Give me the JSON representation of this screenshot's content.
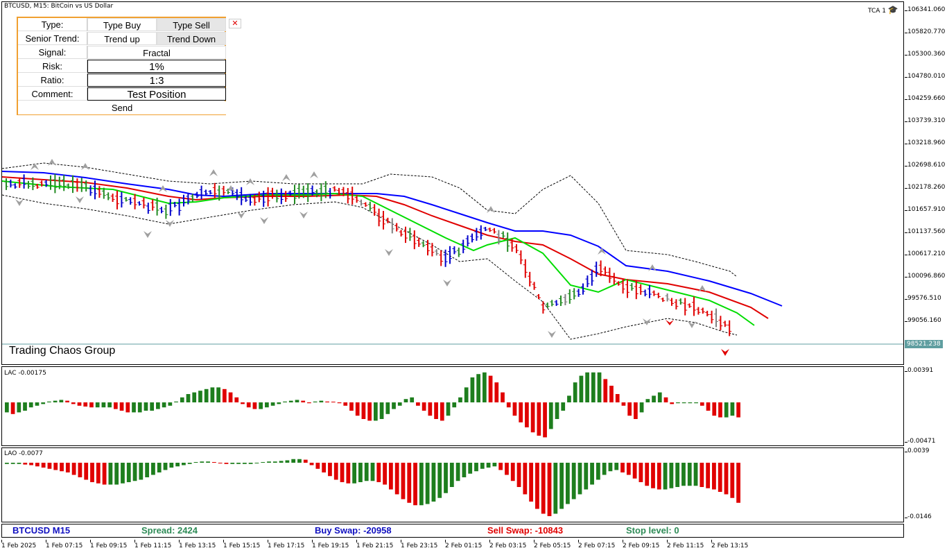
{
  "chart": {
    "symbol_title": "BTCUSD, M15:  BitCoin vs US Dollar",
    "indicator_tag": "TCA 1",
    "watermark": "Trading Chaos Group",
    "current_price": "98521.238",
    "price_ticks": [
      "106341.060",
      "105820.770",
      "105300.360",
      "104780.010",
      "104259.660",
      "103739.310",
      "103218.960",
      "102698.610",
      "102178.260",
      "101657.910",
      "101137.560",
      "100617.210",
      "100096.860",
      "99576.510",
      "99056.160"
    ],
    "time_ticks": [
      "1 Feb 2025",
      "1 Feb 07:15",
      "1 Feb 09:15",
      "1 Feb 11:15",
      "1 Feb 13:15",
      "1 Feb 15:15",
      "1 Feb 17:15",
      "1 Feb 19:15",
      "1 Feb 21:15",
      "1 Feb 23:15",
      "2 Feb 01:15",
      "2 Feb 03:15",
      "2 Feb 05:15",
      "2 Feb 07:15",
      "2 Feb 09:15",
      "2 Feb 11:15",
      "2 Feb 13:15"
    ],
    "colors": {
      "up": "#0000cc",
      "down": "#e00000",
      "neutral": "#808080",
      "green": "#228b22",
      "ma_blue": "#0000ff",
      "ma_red": "#e00000",
      "ma_green": "#00dd00",
      "price_line": "#5f9ea0"
    }
  },
  "panel": {
    "close_icon": "close-x-icon",
    "rows": {
      "type_label": "Type:",
      "buy_label": "Type Buy",
      "sell_label": "Type Sell",
      "trend_label": "Senior Trend:",
      "trend_up": "Trend up",
      "trend_down": "Trend Down",
      "signal_label": "Signal:",
      "signal_value": "Fractal",
      "risk_label": "Risk:",
      "risk_value": "1%",
      "ratio_label": "Ratio:",
      "ratio_value": "1:3",
      "comment_label": "Comment:",
      "comment_value": "Test Position",
      "send_label": "Send"
    }
  },
  "lac": {
    "label": "LAC -0.00175",
    "scale_top": "0.00391",
    "scale_bottom": "-0.00471",
    "values": [
      -0.6,
      -0.7,
      -0.6,
      -0.5,
      -0.3,
      -0.2,
      -0.1,
      0.05,
      0.1,
      0.15,
      0.1,
      -0.1,
      -0.2,
      -0.25,
      -0.3,
      -0.3,
      -0.3,
      -0.3,
      -0.4,
      -0.5,
      -0.6,
      -0.6,
      -0.6,
      -0.5,
      -0.5,
      -0.4,
      -0.3,
      -0.2,
      0.05,
      0.3,
      0.5,
      0.6,
      0.7,
      0.8,
      0.9,
      0.9,
      0.8,
      0.6,
      0.3,
      -0.1,
      -0.3,
      -0.4,
      -0.4,
      -0.3,
      -0.2,
      -0.1,
      0.05,
      0.1,
      0.15,
      0.1,
      -0.05,
      0.05,
      0.1,
      0.05,
      0.02,
      -0.05,
      -0.2,
      -0.5,
      -0.8,
      -1.0,
      -1.1,
      -1.1,
      -1.0,
      -0.7,
      -0.4,
      -0.2,
      0.2,
      0.3,
      -0.2,
      -0.5,
      -0.8,
      -1.0,
      -1.1,
      -0.8,
      -0.3,
      0.3,
      0.9,
      1.5,
      1.7,
      1.8,
      1.6,
      1.2,
      0.6,
      -0.3,
      -0.8,
      -1.2,
      -1.5,
      -1.8,
      -2.0,
      -2.1,
      -1.6,
      -1.0,
      -0.5,
      0.4,
      1.2,
      1.6,
      1.8,
      1.8,
      1.8,
      1.4,
      1.0,
      0.5,
      -0.2,
      -0.8,
      -1.0,
      -0.6,
      0.2,
      0.4,
      0.6,
      0.3,
      -0.1,
      -0.05,
      -0.05,
      -0.05,
      -0.05,
      -0.2,
      -0.5,
      -0.8,
      -0.9,
      -0.9,
      -0.8,
      -0.9
    ]
  },
  "lao": {
    "label": "LAO -0.0077",
    "scale_top": "0.0039",
    "scale_bottom": "-0.0146",
    "values": [
      -0.1,
      -0.1,
      -0.1,
      -0.15,
      -0.2,
      -0.3,
      -0.4,
      -0.5,
      -0.6,
      -0.7,
      -0.8,
      -1.0,
      -1.2,
      -1.4,
      -1.6,
      -1.7,
      -1.8,
      -1.8,
      -1.8,
      -1.7,
      -1.6,
      -1.5,
      -1.4,
      -1.2,
      -1.0,
      -0.8,
      -0.6,
      -0.4,
      -0.3,
      -0.2,
      -0.1,
      0.05,
      0.1,
      0.1,
      0.05,
      -0.05,
      -0.1,
      -0.1,
      -0.1,
      -0.1,
      -0.1,
      -0.05,
      0.05,
      0.1,
      0.1,
      0.15,
      0.2,
      0.3,
      0.3,
      0.25,
      -0.2,
      -0.5,
      -0.8,
      -1.1,
      -1.4,
      -1.6,
      -1.7,
      -1.7,
      -1.6,
      -1.5,
      -1.5,
      -1.6,
      -1.8,
      -2.2,
      -2.6,
      -3.0,
      -3.3,
      -3.5,
      -3.5,
      -3.4,
      -3.2,
      -2.9,
      -2.5,
      -2.0,
      -1.5,
      -1.2,
      -0.9,
      -0.7,
      -0.5,
      -0.4,
      -0.3,
      -0.6,
      -1.0,
      -1.5,
      -2.0,
      -2.6,
      -3.2,
      -3.8,
      -4.2,
      -4.4,
      -4.2,
      -3.8,
      -3.4,
      -3.0,
      -2.6,
      -2.2,
      -1.8,
      -1.4,
      -1.0,
      -0.7,
      -0.6,
      -0.8,
      -1.0,
      -1.3,
      -1.6,
      -1.9,
      -2.1,
      -2.2,
      -2.2,
      -2.1,
      -2.0,
      -1.9,
      -1.9,
      -1.9,
      -2.0,
      -2.1,
      -2.2,
      -2.4,
      -2.6,
      -2.9,
      -3.3
    ]
  },
  "status_bar": {
    "symbol": "BTCUSD M15",
    "spread": "Spread: 2424",
    "buy_swap": "Buy Swap: -20958",
    "sell_swap": "Sell Swap: -10843",
    "stop_level": "Stop level: 0"
  }
}
